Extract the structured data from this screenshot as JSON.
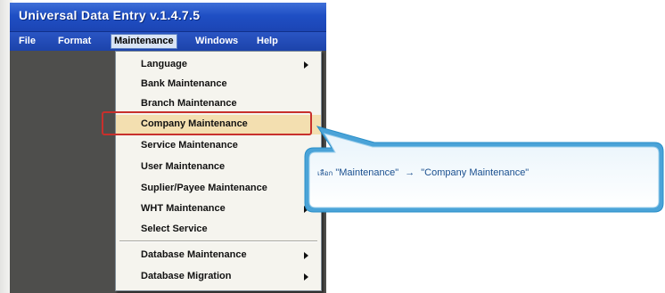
{
  "window": {
    "title": "Universal Data Entry v.1.4.7.5"
  },
  "menubar": {
    "items": [
      {
        "label": "File"
      },
      {
        "label": "Format"
      },
      {
        "label": "Maintenance",
        "active": true
      },
      {
        "label": "Windows"
      },
      {
        "label": "Help"
      }
    ]
  },
  "dropdown": {
    "items": [
      {
        "label": "Language",
        "submenu": true
      },
      {
        "label": "Bank Maintenance",
        "submenu": false
      },
      {
        "label": "Branch Maintenance",
        "submenu": false
      },
      {
        "label": "Company Maintenance",
        "submenu": false,
        "highlighted": true
      },
      {
        "label": "Service Maintenance",
        "submenu": false
      },
      {
        "label": "User Maintenance",
        "submenu": false
      },
      {
        "label": "Suplier/Payee Maintenance",
        "submenu": false
      },
      {
        "label": "WHT Maintenance",
        "submenu": true
      },
      {
        "label": "Select Service",
        "submenu": false
      },
      {
        "label": "Database Maintenance",
        "submenu": true
      },
      {
        "label": "Database Migration",
        "submenu": true
      }
    ]
  },
  "callout": {
    "prefix": "เลือก",
    "from": "\"Maintenance\"",
    "arrow": "→",
    "to": "\"Company Maintenance\""
  },
  "colors": {
    "titlebar": "#1f4fc4",
    "menu_highlight": "#f3dfb0",
    "annotation_frame": "#c8302c",
    "callout_border": "#2a8fc8",
    "callout_text": "#1a4f8f"
  }
}
